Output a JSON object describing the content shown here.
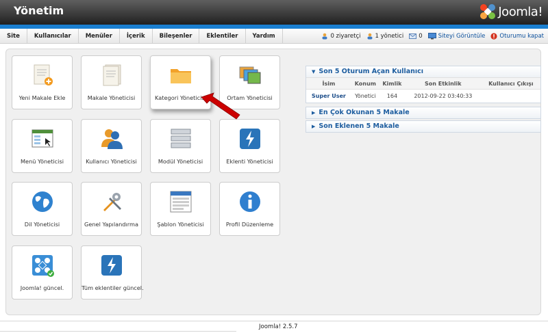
{
  "header": {
    "title": "Yönetim",
    "logo_text": "Joomla!",
    "colors": {
      "bar": "#2a2a2a",
      "stripe": "#1a7fd0"
    }
  },
  "menu": {
    "items": [
      "Site",
      "Kullanıcılar",
      "Menüler",
      "İçerik",
      "Bileşenler",
      "Eklentiler",
      "Yardım"
    ]
  },
  "status": {
    "visitors": "0 ziyaretçi",
    "admins": "1 yönetici",
    "messages": "0",
    "view_site": "Siteyi Görüntüle",
    "logout": "Oturumu kapat"
  },
  "tiles": [
    {
      "label": "Yeni Makale Ekle",
      "icon": "new-article-icon"
    },
    {
      "label": "Makale Yöneticisi",
      "icon": "article-manager-icon"
    },
    {
      "label": "Kategori Yöneticisi",
      "icon": "folder-icon"
    },
    {
      "label": "Ortam Yöneticisi",
      "icon": "media-icon"
    },
    {
      "label": "Menü Yöneticisi",
      "icon": "menu-manager-icon"
    },
    {
      "label": "Kullanıcı Yöneticisi",
      "icon": "users-icon"
    },
    {
      "label": "Modül Yöneticisi",
      "icon": "module-icon"
    },
    {
      "label": "Eklenti Yöneticisi",
      "icon": "plugin-icon"
    },
    {
      "label": "Dil Yöneticisi",
      "icon": "globe-icon"
    },
    {
      "label": "Genel Yapılandırma",
      "icon": "tools-icon"
    },
    {
      "label": "Şablon Yöneticisi",
      "icon": "template-icon"
    },
    {
      "label": "Profil Düzenleme",
      "icon": "info-icon"
    },
    {
      "label": "Joomla! güncel.",
      "icon": "joomla-update-icon"
    },
    {
      "label": "Tüm eklentiler güncel.",
      "icon": "extensions-update-icon"
    }
  ],
  "logged_in": {
    "title": "Son 5 Oturum Açan Kullanıcı",
    "columns": [
      "İsim",
      "Konum",
      "Kimlik",
      "Son Etkinlik",
      "Kullanıcı Çıkışı"
    ],
    "rows": [
      [
        "Super User",
        "Yönetici",
        "164",
        "2012-09-22 03:40:33",
        ""
      ]
    ]
  },
  "popular": {
    "title": "En Çok Okunan 5 Makale"
  },
  "latest": {
    "title": "Son Eklenen 5 Makale"
  },
  "footer": {
    "version": "Joomla! 2.5.7"
  },
  "annotation": {
    "arrow_color": "#cc0000",
    "active_tile": "Kategori Yöneticisi"
  }
}
